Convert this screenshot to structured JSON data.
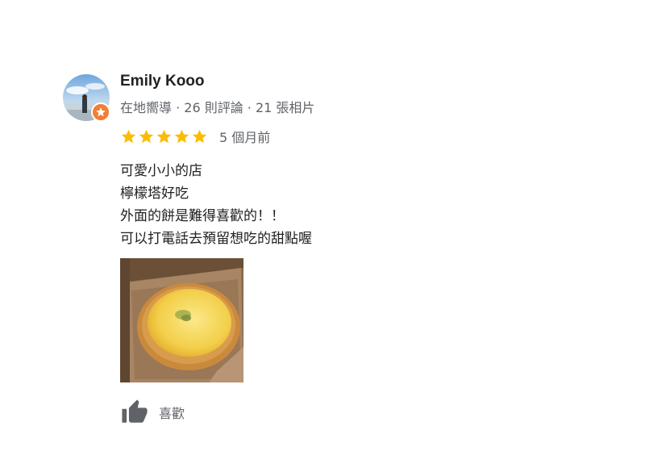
{
  "review": {
    "author_name": "Emily Kooo",
    "author_meta": "在地嚮導 · 26 則評論 · 21 張相片",
    "rating": 5,
    "rating_max": 5,
    "date": "5 個月前",
    "text_lines": [
      "可愛小小的店",
      "檸檬塔好吃",
      "外面的餅是難得喜歡的！！",
      "可以打電話去預留想吃的甜點喔"
    ],
    "like_label": "喜歡"
  },
  "icons": {
    "avatar": "profile-photo",
    "badge": "local-guide-star-icon",
    "star": "star-icon",
    "like": "thumbs-up-icon"
  },
  "colors": {
    "star": "#fbbc04",
    "badge": "#f27d33",
    "meta_text": "#5f6368",
    "body_text": "#202124"
  }
}
